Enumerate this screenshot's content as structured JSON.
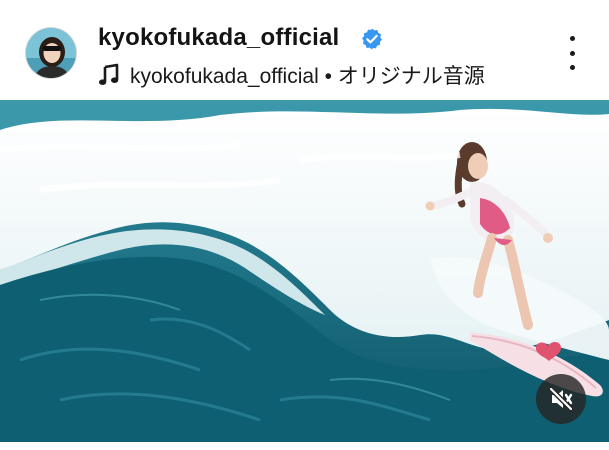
{
  "post": {
    "username": "kyokofukada_official",
    "verified": true,
    "audio_text": "kyokofukada_official • オリジナル音源"
  },
  "icons": {
    "avatar": "profile-photo",
    "verified": "verified-badge-icon",
    "audio": "music-note-icon",
    "more": "more-options-icon",
    "mute": "speaker-muted-icon"
  },
  "video": {
    "muted": true
  },
  "colors": {
    "verified_blue": "#3897f0",
    "text": "#141414",
    "mute_bg": "#262626"
  }
}
